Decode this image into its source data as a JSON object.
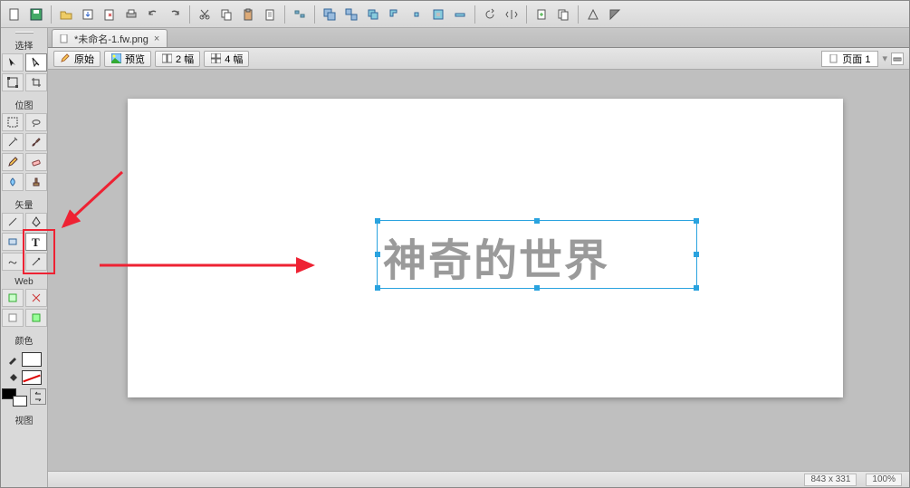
{
  "tab": {
    "title": "*未命名-1.fw.png"
  },
  "view_modes": {
    "original": "原始",
    "preview": "预览",
    "two_up": "2 幅",
    "four_up": "4 幅"
  },
  "page_selector": {
    "label": "页面 1"
  },
  "toolbox": {
    "sections": {
      "select": "选择",
      "bitmap": "位图",
      "vector": "矢量",
      "web": "Web",
      "colors": "颜色",
      "view": "视图"
    }
  },
  "canvas": {
    "text": "神奇的世界"
  },
  "status": {
    "dimensions": "843 x 331",
    "zoom": "100%"
  },
  "top_tool_icons": [
    "new-doc",
    "save",
    "open",
    "import",
    "export-page",
    "print",
    "undo",
    "redo",
    "cut",
    "copy",
    "paste",
    "clipboard",
    "sep",
    "align-distribute",
    "group",
    "ungroup",
    "combine",
    "subtract",
    "intersect",
    "punch",
    "flatten",
    "sep",
    "rotate-90",
    "flip-h",
    "sep",
    "add-page",
    "crop",
    "sep",
    "sharpen",
    "mask"
  ]
}
